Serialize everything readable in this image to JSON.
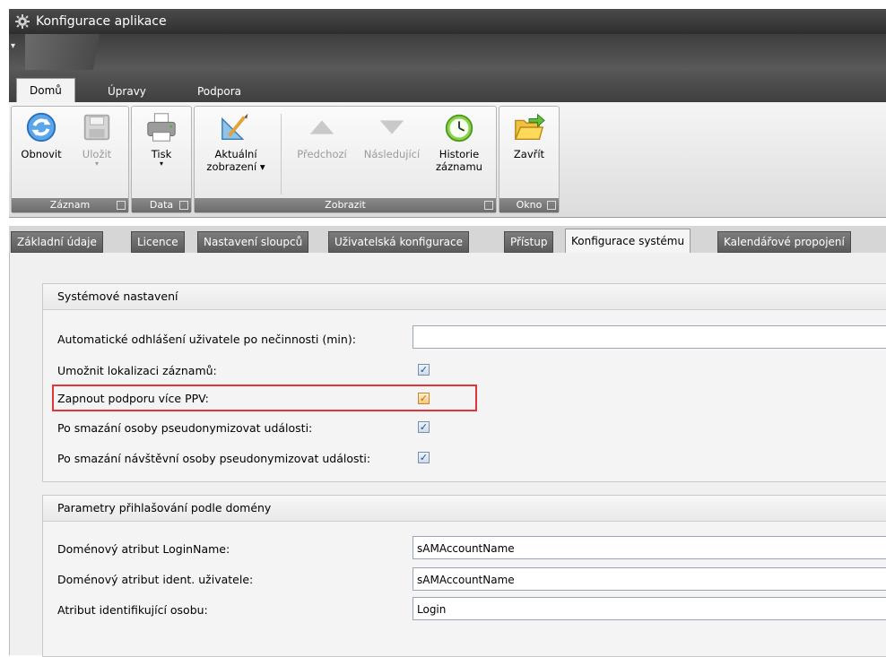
{
  "window": {
    "title": "Konfigurace aplikace"
  },
  "qat": {
    "menu_glyph": "▾"
  },
  "ribbon_tabs": [
    {
      "label": "Domů"
    },
    {
      "label": "Úpravy"
    },
    {
      "label": "Podpora"
    }
  ],
  "ribbon": {
    "groups": [
      {
        "label": "Záznam"
      },
      {
        "label": "Data"
      },
      {
        "label": "Zobrazit"
      },
      {
        "label": "Okno"
      }
    ],
    "buttons": {
      "refresh": "Obnovit",
      "save": "Uložit",
      "print": "Tisk",
      "current_view_1": "Aktuální",
      "current_view_2": "zobrazení",
      "previous": "Předchozí",
      "next": "Následující",
      "history_1": "Historie",
      "history_2": "záznamu",
      "close": "Zavřít"
    },
    "dropdown_arrow": "▾"
  },
  "page_tabs": [
    {
      "label": "Základní údaje"
    },
    {
      "label": "Licence"
    },
    {
      "label": "Nastavení sloupců"
    },
    {
      "label": "Uživatelská konfigurace"
    },
    {
      "label": "Přístup"
    },
    {
      "label": "Konfigurace systému"
    },
    {
      "label": "Kalendářové propojení"
    }
  ],
  "system_settings": {
    "header": "Systémové nastavení",
    "auto_logout_label": "Automatické odhlášení uživatele po nečinnosti (min):",
    "auto_logout_value": "",
    "localization_label": "Umožnit lokalizaci záznamů:",
    "multi_ppv_label": "Zapnout podporu více PPV:",
    "pseudonymize_person_label": "Po smazání osoby pseudonymizovat události:",
    "pseudonymize_visitor_label": "Po smazání návštěvní osoby pseudonymizovat události:",
    "check_glyph": "✓"
  },
  "domain_login": {
    "header": "Parametry přihlašování podle domény",
    "login_name_label": "Doménový atribut LoginName:",
    "login_name_value": "sAMAccountName",
    "user_ident_label": "Doménový atribut ident. uživatele:",
    "user_ident_value": "sAMAccountName",
    "person_attr_label": "Atribut identifikující osobu:",
    "person_attr_value": "Login"
  },
  "colors": {
    "highlight": "#e0353a",
    "accent_blue": "#1f4f9a"
  }
}
